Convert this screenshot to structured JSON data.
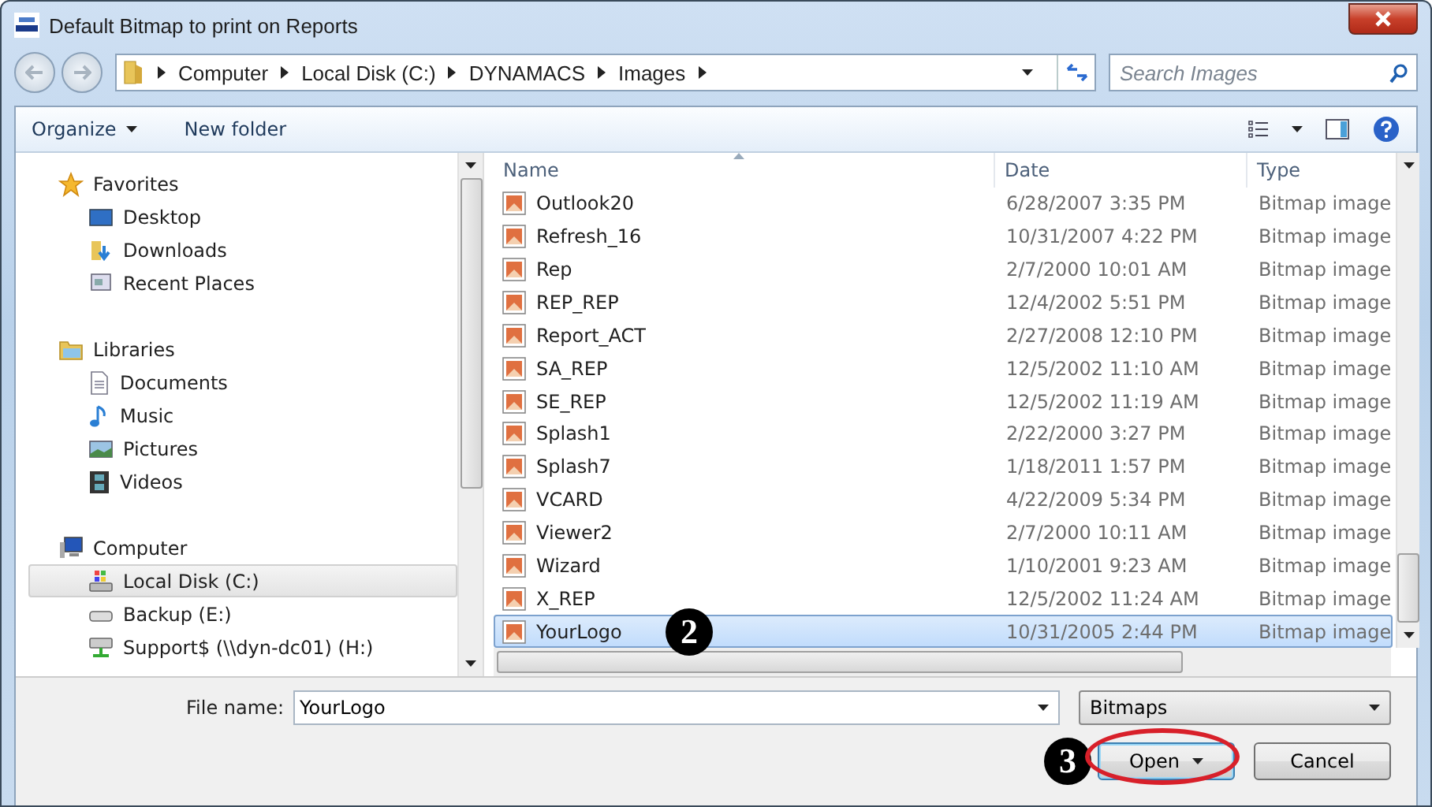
{
  "window": {
    "title": "Default Bitmap to print on Reports"
  },
  "address_bar": {
    "segments": [
      "Computer",
      "Local Disk (C:)",
      "DYNAMACS",
      "Images"
    ]
  },
  "search": {
    "placeholder": "Search Images"
  },
  "toolbar": {
    "organize": "Organize",
    "new_folder": "New folder"
  },
  "sidebar": {
    "sections": [
      {
        "label": "Favorites",
        "items": [
          {
            "label": "Desktop",
            "selected": false
          },
          {
            "label": "Downloads",
            "selected": false
          },
          {
            "label": "Recent Places",
            "selected": false
          }
        ]
      },
      {
        "label": "Libraries",
        "items": [
          {
            "label": "Documents",
            "selected": false
          },
          {
            "label": "Music",
            "selected": false
          },
          {
            "label": "Pictures",
            "selected": false
          },
          {
            "label": "Videos",
            "selected": false
          }
        ]
      },
      {
        "label": "Computer",
        "items": [
          {
            "label": "Local Disk (C:)",
            "selected": true
          },
          {
            "label": "Backup (E:)",
            "selected": false
          },
          {
            "label": "Support$ (\\\\dyn-dc01) (H:)",
            "selected": false
          }
        ]
      }
    ]
  },
  "table": {
    "columns": [
      "Name",
      "Date",
      "Type"
    ],
    "rows": [
      {
        "name": "Outlook20",
        "date": "6/28/2007 3:35 PM",
        "type": "Bitmap image",
        "selected": false
      },
      {
        "name": "Refresh_16",
        "date": "10/31/2007 4:22 PM",
        "type": "Bitmap image",
        "selected": false
      },
      {
        "name": "Rep",
        "date": "2/7/2000 10:01 AM",
        "type": "Bitmap image",
        "selected": false
      },
      {
        "name": "REP_REP",
        "date": "12/4/2002 5:51 PM",
        "type": "Bitmap image",
        "selected": false
      },
      {
        "name": "Report_ACT",
        "date": "2/27/2008 12:10 PM",
        "type": "Bitmap image",
        "selected": false
      },
      {
        "name": "SA_REP",
        "date": "12/5/2002 11:10 AM",
        "type": "Bitmap image",
        "selected": false
      },
      {
        "name": "SE_REP",
        "date": "12/5/2002 11:19 AM",
        "type": "Bitmap image",
        "selected": false
      },
      {
        "name": "Splash1",
        "date": "2/22/2000 3:27 PM",
        "type": "Bitmap image",
        "selected": false
      },
      {
        "name": "Splash7",
        "date": "1/18/2011 1:57 PM",
        "type": "Bitmap image",
        "selected": false
      },
      {
        "name": "VCARD",
        "date": "4/22/2009 5:34 PM",
        "type": "Bitmap image",
        "selected": false
      },
      {
        "name": "Viewer2",
        "date": "2/7/2000 10:11 AM",
        "type": "Bitmap image",
        "selected": false
      },
      {
        "name": "Wizard",
        "date": "1/10/2001 9:23 AM",
        "type": "Bitmap image",
        "selected": false
      },
      {
        "name": "X_REP",
        "date": "12/5/2002 11:24 AM",
        "type": "Bitmap image",
        "selected": false
      },
      {
        "name": "YourLogo",
        "date": "10/31/2005 2:44 PM",
        "type": "Bitmap image",
        "selected": true,
        "callout": "2"
      }
    ]
  },
  "file_name": {
    "label": "File name:",
    "value": "YourLogo"
  },
  "file_type": {
    "value": "Bitmaps"
  },
  "buttons": {
    "open": {
      "label": "Open",
      "callout": "3",
      "circled": true
    },
    "cancel": {
      "label": "Cancel"
    }
  }
}
